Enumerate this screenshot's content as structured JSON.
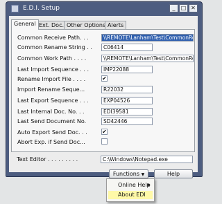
{
  "window": {
    "title": "E.D.I. Setup"
  },
  "titlebar_buttons": {
    "minimize": "_",
    "maximize": "□",
    "close": "✕"
  },
  "tabs": [
    "General",
    "Ext. Doc.",
    "Other Options",
    "Alerts"
  ],
  "fields": [
    {
      "label": "Common Receive Path. . .",
      "value": "\\\\REMOTE\\Lanham\\Test\\CommonReceive\\",
      "selected": true
    },
    {
      "label": "Common Rename String . .",
      "value": "C06414"
    },
    {
      "label": "Common Work Path . . . .",
      "value": "\\\\REMOTE\\Lanham\\Test\\CommonRecei..."
    },
    {
      "label": "Last Import Sequence . . .",
      "value": "IMP22088"
    },
    {
      "label": "Rename Import File . . . .",
      "checked": true
    },
    {
      "label": "Import Rename Seque...",
      "value": "R22032"
    },
    {
      "label": "Last Export Sequence . . .",
      "value": "EXP04526"
    },
    {
      "label": "Last Internal Doc. No. . .",
      "value": "EDI39581"
    },
    {
      "label": "Last Send Document No.",
      "value": "SD42446"
    },
    {
      "label": "Auto Export Send Doc. . .",
      "checked": true
    },
    {
      "label": "Abort Exp. if Send Doc...",
      "checked": false
    },
    {
      "label": "Text Editor . . . . . . . . .",
      "value": "C:\\Windows\\Notepad.exe"
    }
  ],
  "buttons": {
    "functions": "Functions",
    "functions_arrow": "▼",
    "help": "Help"
  },
  "menu": {
    "items": [
      {
        "label": "Online Help",
        "has_submenu": true
      },
      {
        "label": "About EDI",
        "highlighted": true
      }
    ],
    "submenu_arrow": "▶"
  },
  "check_mark": "✔",
  "colors": {
    "titlebar": "#4d5d80",
    "selected_field": "#2f5fae",
    "menu_highlight": "#fff9a8"
  }
}
